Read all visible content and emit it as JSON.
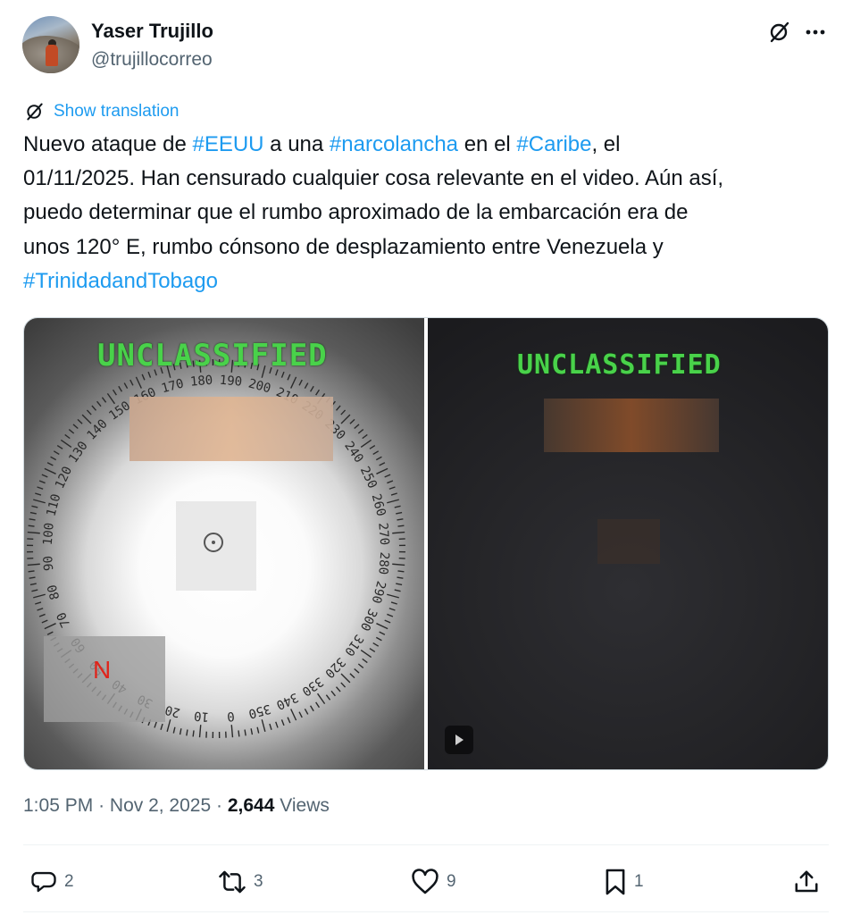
{
  "author": {
    "name": "Yaser Trujillo",
    "handle": "@trujillocorreo"
  },
  "icons": {
    "grok": "grok-icon",
    "more": "more-icon",
    "translate": "translate-icon",
    "reply": "reply-icon",
    "retweet": "retweet-icon",
    "like": "like-icon",
    "bookmark": "bookmark-icon",
    "share": "share-icon",
    "play": "play-icon"
  },
  "translation": {
    "label": "Show translation"
  },
  "tweet": {
    "segments": [
      {
        "text": "Nuevo ataque de ",
        "tag": false
      },
      {
        "text": "#EEUU",
        "tag": true
      },
      {
        "text": " a una ",
        "tag": false
      },
      {
        "text": "#narcolancha",
        "tag": true
      },
      {
        "text": " en el ",
        "tag": false
      },
      {
        "text": "#Caribe",
        "tag": true
      },
      {
        "text": ", el\n01/11/2025. Han censurado cualquier cosa relevante en el video. Aún así,\npuedo determinar que el rumbo aproximado de la embarcación era de\nunos 120° E, rumbo cónsono de desplazamiento entre Venezuela y\n",
        "tag": false
      },
      {
        "text": "#TrinidadandTobago",
        "tag": true
      }
    ]
  },
  "media": {
    "left_overlay": "UNCLASSIFIED",
    "right_overlay": "UNCLASSIFIED",
    "north_label": "N",
    "compass_ticks": [
      "0",
      "10",
      "20",
      "30",
      "40",
      "50",
      "60",
      "70",
      "80",
      "90",
      "100",
      "110",
      "120",
      "130",
      "140",
      "150",
      "160",
      "170",
      "180",
      "190",
      "200",
      "210",
      "220",
      "230",
      "240",
      "250",
      "260",
      "270",
      "280",
      "290",
      "300",
      "310",
      "320",
      "330",
      "340",
      "350"
    ]
  },
  "meta": {
    "time": "1:05 PM",
    "separator": "·",
    "date": "Nov 2, 2025",
    "views_count": "2,644",
    "views_label": "Views"
  },
  "actions": {
    "replies": "2",
    "reposts": "3",
    "likes": "9",
    "bookmarks": "1"
  },
  "colors": {
    "accent": "#1d9bf0",
    "text": "#0f1419",
    "secondary": "#536471",
    "overlay_green": "#49d24a",
    "north_red": "#e0241b"
  }
}
